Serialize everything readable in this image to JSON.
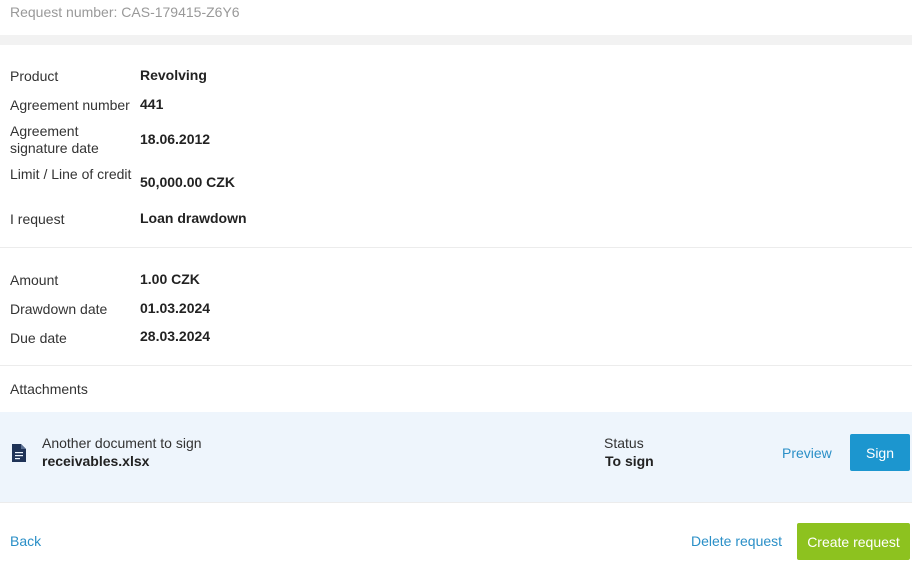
{
  "header": {
    "request_number": "Request number: CAS-179415-Z6Y6"
  },
  "details": {
    "product_label": "Product",
    "product_value": "Revolving",
    "agreement_number_label": "Agreement number",
    "agreement_number_value": "441",
    "signature_date_label": "Agreement signature date",
    "signature_date_value": "18.06.2012",
    "limit_label": "Limit / Line of credit",
    "limit_value": "50,000.00 CZK",
    "request_label": "I request",
    "request_value": "Loan drawdown"
  },
  "drawdown": {
    "amount_label": "Amount",
    "amount_value": "1.00 CZK",
    "drawdown_date_label": "Drawdown date",
    "drawdown_date_value": "01.03.2024",
    "due_date_label": "Due date",
    "due_date_value": "28.03.2024"
  },
  "attachments": {
    "title": "Attachments",
    "item": {
      "icon": "document-icon",
      "title": "Another document to sign",
      "file_name": "receivables.xlsx",
      "status_label": "Status",
      "status_value": "To sign",
      "preview_label": "Preview",
      "sign_label": "Sign"
    }
  },
  "footer": {
    "back_label": "Back",
    "delete_label": "Delete request",
    "create_label": "Create request"
  },
  "colors": {
    "link": "#2a8fc7",
    "sign_button": "#1c96cf",
    "create_button": "#8dc21f",
    "attachment_background": "#eef5fc"
  }
}
